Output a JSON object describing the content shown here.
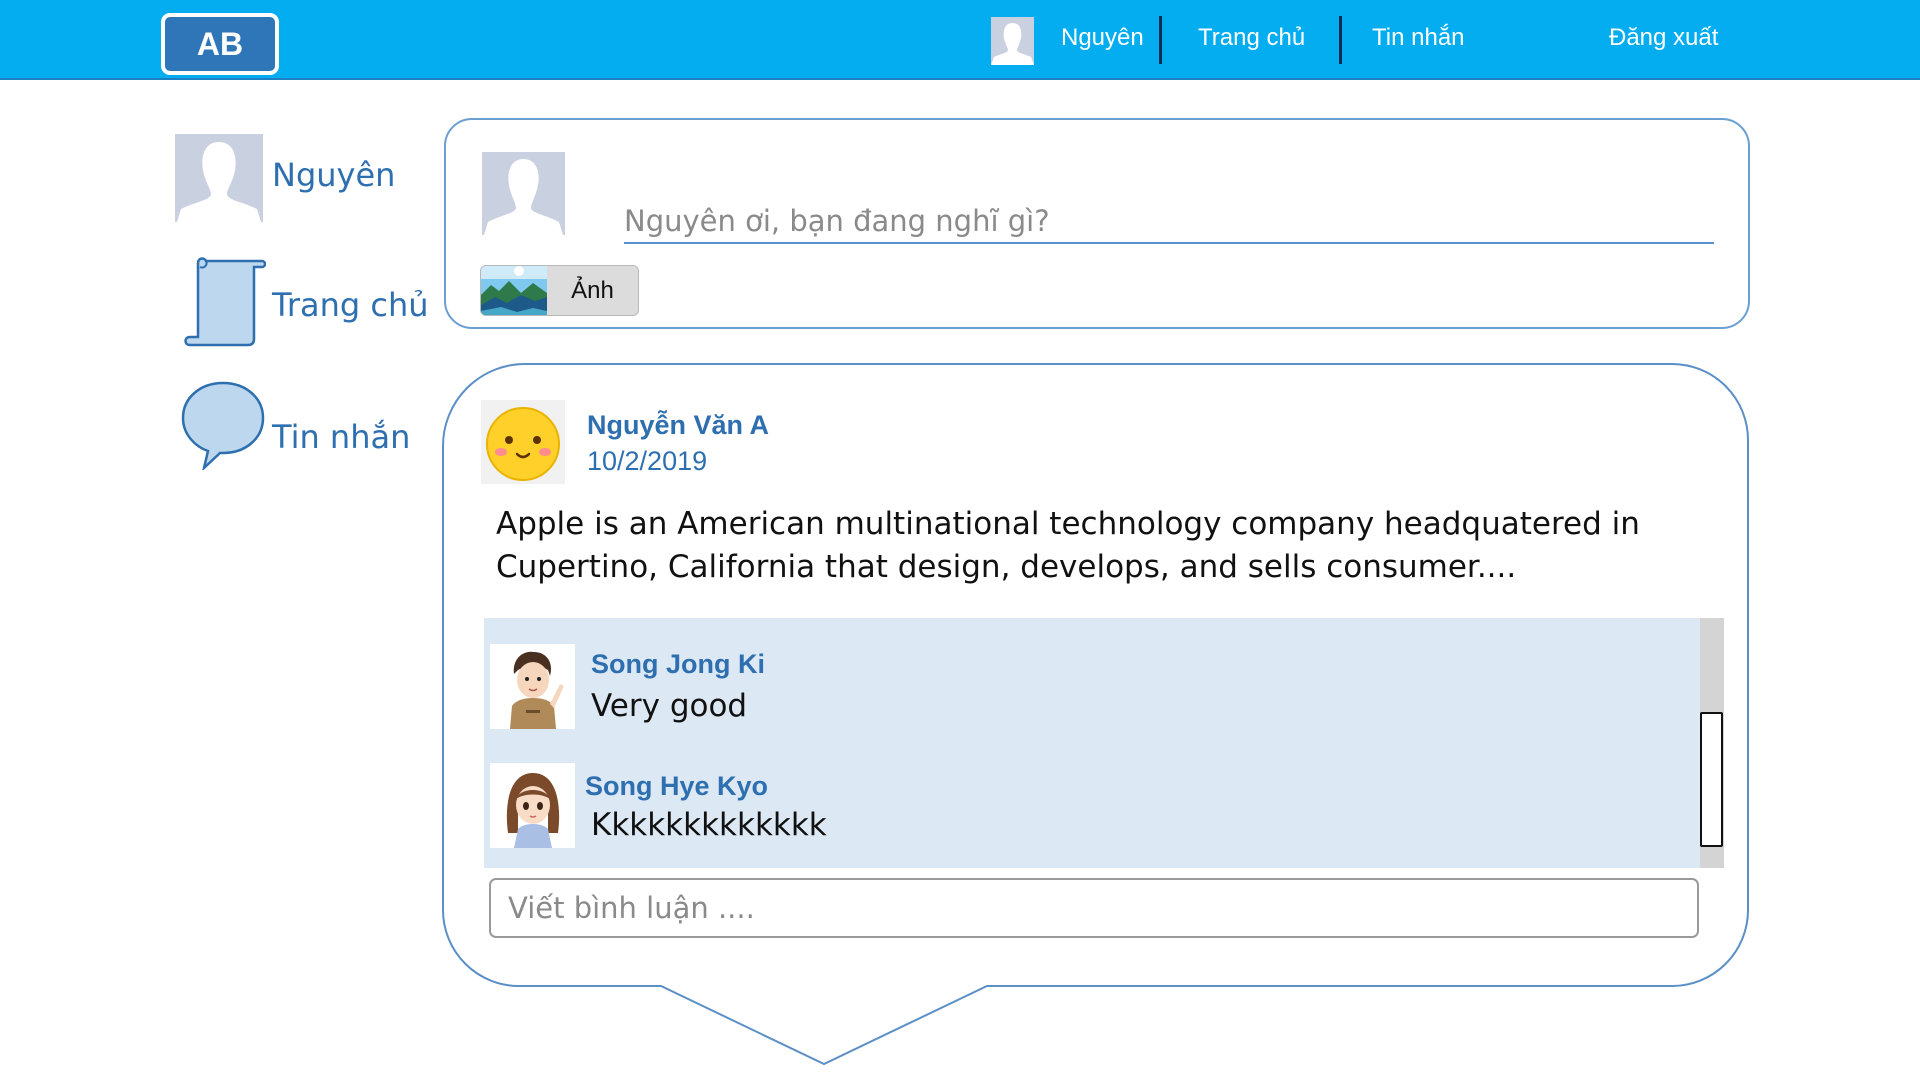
{
  "header": {
    "logo": "AB",
    "user_name": "Nguyên",
    "home": "Trang chủ",
    "messages": "Tin nhắn",
    "logout": "Đăng xuất"
  },
  "sidebar": {
    "items": [
      {
        "label": "Nguyên",
        "icon": "profile-avatar-icon"
      },
      {
        "label": "Trang chủ",
        "icon": "scroll-icon"
      },
      {
        "label": "Tin nhắn",
        "icon": "speech-bubble-icon"
      }
    ]
  },
  "composer": {
    "placeholder": "Nguyên ơi, bạn đang nghĩ gì?",
    "photo_button": "Ảnh"
  },
  "post": {
    "author": "Nguyễn Văn A",
    "date": "10/2/2019",
    "text": "Apple is an American multinational technology company headquatered in Cupertino, California that design, develops, and sells consumer....",
    "comments": [
      {
        "author": "Song Jong Ki",
        "text": "Very good"
      },
      {
        "author": "Song Hye Kyo",
        "text": "Kkkkkkkkkkkkk"
      }
    ],
    "comment_placeholder": "Viết bình luận ...."
  },
  "colors": {
    "header_bg": "#03adef",
    "accent_blue": "#2e6fb0",
    "comment_bg": "#dde8f5",
    "border_blue": "#6b9fd2"
  }
}
